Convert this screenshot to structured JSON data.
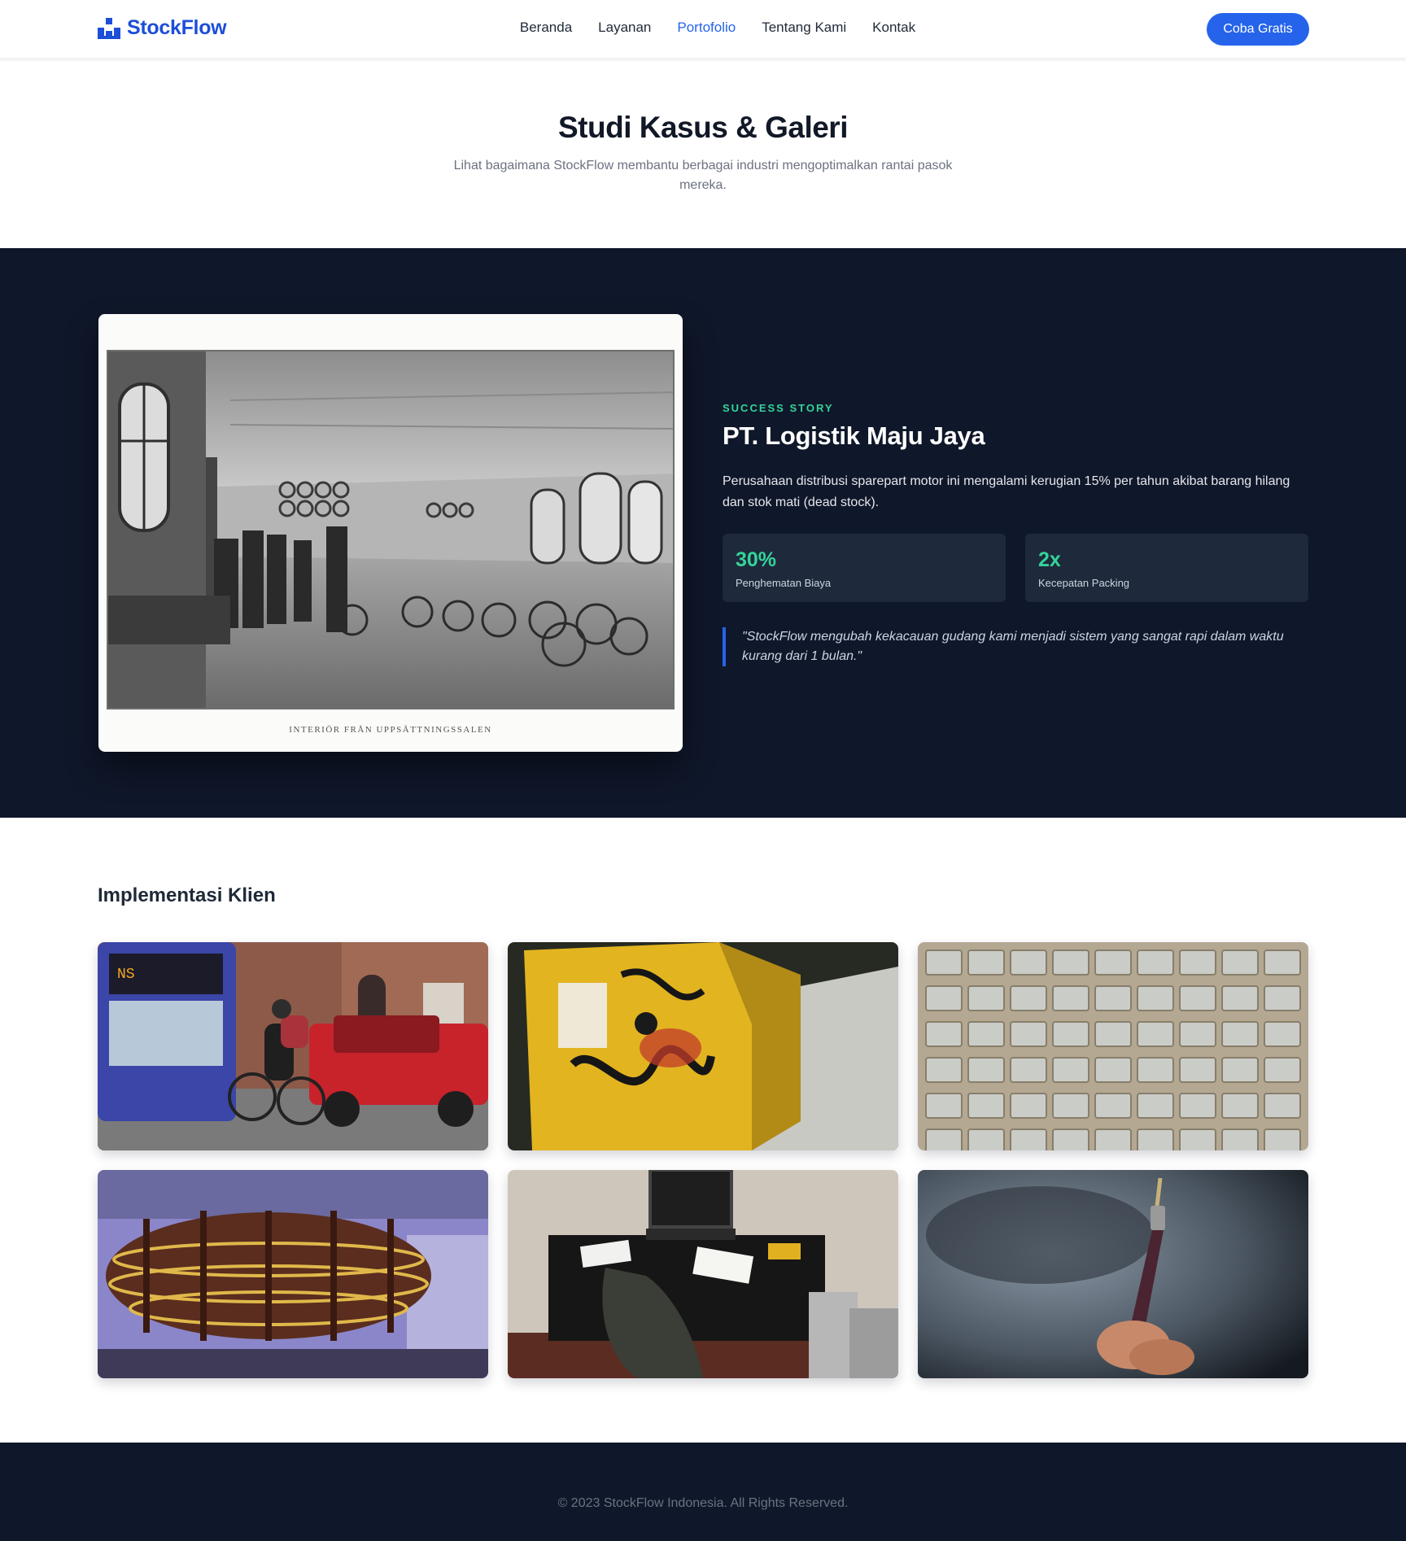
{
  "brand": {
    "name": "StockFlow",
    "icon": "warehouse-boxes-icon",
    "color": "#1d4ed8"
  },
  "nav": {
    "items": [
      {
        "label": "Beranda",
        "active": false
      },
      {
        "label": "Layanan",
        "active": false
      },
      {
        "label": "Portofolio",
        "active": true
      },
      {
        "label": "Tentang Kami",
        "active": false
      },
      {
        "label": "Kontak",
        "active": false
      }
    ],
    "cta_label": "Coba Gratis"
  },
  "hero": {
    "title": "Studi Kasus & Galeri",
    "subtitle": "Lihat bagaimana StockFlow membantu berbagai industri mengoptimalkan rantai pasok mereka."
  },
  "case_study": {
    "eyebrow": "SUCCESS STORY",
    "title": "PT. Logistik Maju Jaya",
    "description": "Perusahaan distribusi sparepart motor ini mengalami kerugian 15% per tahun akibat barang hilang dan stok mati (dead stock).",
    "image_caption": "INTERIÖR FRÅN UPPSÄTTNINGSSALEN",
    "stats": [
      {
        "value": "30%",
        "label": "Penghematan Biaya"
      },
      {
        "value": "2x",
        "label": "Kecepatan Packing"
      }
    ],
    "quote": "\"StockFlow mengubah kekacauan gudang kami menjadi sistem yang sangat rapi dalam waktu kurang dari 1 bulan.\""
  },
  "gallery": {
    "title": "Implementasi Klien",
    "images": [
      "tram-cyclist-photo",
      "yellow-graffiti-box-photo",
      "storage-drawers-photo",
      "mall-sculpture-photo",
      "cluttered-desk-photo",
      "audio-jack-photo"
    ]
  },
  "footer": {
    "copyright": "© 2023 StockFlow Indonesia. All Rights Reserved."
  },
  "colors": {
    "primary": "#2563eb",
    "dark_bg": "#0f172a",
    "accent_green": "#34d399",
    "card_bg": "#1e293b"
  }
}
